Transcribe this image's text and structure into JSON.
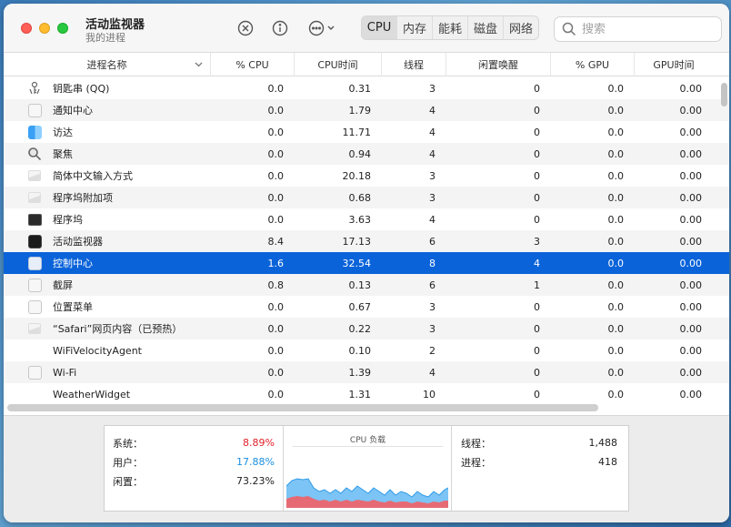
{
  "window": {
    "title": "活动监视器",
    "subtitle": "我的进程"
  },
  "toolbar": {
    "tabs": [
      "CPU",
      "内存",
      "能耗",
      "磁盘",
      "网络"
    ],
    "active_tab": "CPU",
    "search_placeholder": "搜索"
  },
  "columns": {
    "name": "进程名称",
    "cpu": "% CPU",
    "cpu_time": "CPU时间",
    "threads": "线程",
    "idle_wake": "闲置唤醒",
    "gpu": "% GPU",
    "gpu_time": "GPU时间"
  },
  "processes": [
    {
      "name": "钥匙串 (QQ)",
      "icon": "keychain-icon",
      "cpu": "0.0",
      "cpu_time": "0.31",
      "threads": "3",
      "wake": "0",
      "gpu": "0.0",
      "gpu_time": "0.00"
    },
    {
      "name": "通知中心",
      "icon": "blank-app-icon",
      "cpu": "0.0",
      "cpu_time": "1.79",
      "threads": "4",
      "wake": "0",
      "gpu": "0.0",
      "gpu_time": "0.00"
    },
    {
      "name": "访达",
      "icon": "finder-icon",
      "cpu": "0.0",
      "cpu_time": "11.71",
      "threads": "4",
      "wake": "0",
      "gpu": "0.0",
      "gpu_time": "0.00"
    },
    {
      "name": "聚焦",
      "icon": "spotlight-icon",
      "cpu": "0.0",
      "cpu_time": "0.94",
      "threads": "4",
      "wake": "0",
      "gpu": "0.0",
      "gpu_time": "0.00"
    },
    {
      "name": "简体中文输入方式",
      "icon": "generic-process-icon",
      "cpu": "0.0",
      "cpu_time": "20.18",
      "threads": "3",
      "wake": "0",
      "gpu": "0.0",
      "gpu_time": "0.00"
    },
    {
      "name": "程序坞附加项",
      "icon": "generic-process-icon",
      "cpu": "0.0",
      "cpu_time": "0.68",
      "threads": "3",
      "wake": "0",
      "gpu": "0.0",
      "gpu_time": "0.00"
    },
    {
      "name": "程序坞",
      "icon": "dock-icon",
      "cpu": "0.0",
      "cpu_time": "3.63",
      "threads": "4",
      "wake": "0",
      "gpu": "0.0",
      "gpu_time": "0.00"
    },
    {
      "name": "活动监视器",
      "icon": "activity-monitor-icon",
      "cpu": "8.4",
      "cpu_time": "17.13",
      "threads": "6",
      "wake": "3",
      "gpu": "0.0",
      "gpu_time": "0.00"
    },
    {
      "name": "控制中心",
      "icon": "control-center-icon",
      "cpu": "1.6",
      "cpu_time": "32.54",
      "threads": "8",
      "wake": "4",
      "gpu": "0.0",
      "gpu_time": "0.00"
    },
    {
      "name": "截屏",
      "icon": "blank-app-icon",
      "cpu": "0.8",
      "cpu_time": "0.13",
      "threads": "6",
      "wake": "1",
      "gpu": "0.0",
      "gpu_time": "0.00"
    },
    {
      "name": "位置菜单",
      "icon": "blank-app-icon",
      "cpu": "0.0",
      "cpu_time": "0.67",
      "threads": "3",
      "wake": "0",
      "gpu": "0.0",
      "gpu_time": "0.00"
    },
    {
      "name": "“Safari”网页内容（已预热）",
      "icon": "generic-process-icon",
      "cpu": "0.0",
      "cpu_time": "0.22",
      "threads": "3",
      "wake": "0",
      "gpu": "0.0",
      "gpu_time": "0.00"
    },
    {
      "name": "WiFiVelocityAgent",
      "icon": "no-icon",
      "cpu": "0.0",
      "cpu_time": "0.10",
      "threads": "2",
      "wake": "0",
      "gpu": "0.0",
      "gpu_time": "0.00"
    },
    {
      "name": "Wi-Fi",
      "icon": "blank-app-icon",
      "cpu": "0.0",
      "cpu_time": "1.39",
      "threads": "4",
      "wake": "0",
      "gpu": "0.0",
      "gpu_time": "0.00"
    },
    {
      "name": "WeatherWidget",
      "icon": "no-icon",
      "cpu": "0.0",
      "cpu_time": "1.31",
      "threads": "10",
      "wake": "0",
      "gpu": "0.0",
      "gpu_time": "0.00"
    }
  ],
  "selected_row": 8,
  "summary": {
    "system_label": "系统：",
    "system_value": "8.89%",
    "user_label": "用户：",
    "user_value": "17.88%",
    "idle_label": "闲置：",
    "idle_value": "73.23%",
    "chart_title": "CPU 负载",
    "threads_label": "线程：",
    "threads_value": "1,488",
    "processes_label": "进程：",
    "processes_value": "418"
  },
  "colors": {
    "selection": "#0a63d9",
    "system": "#e0222b",
    "user": "#1c8fe0"
  }
}
